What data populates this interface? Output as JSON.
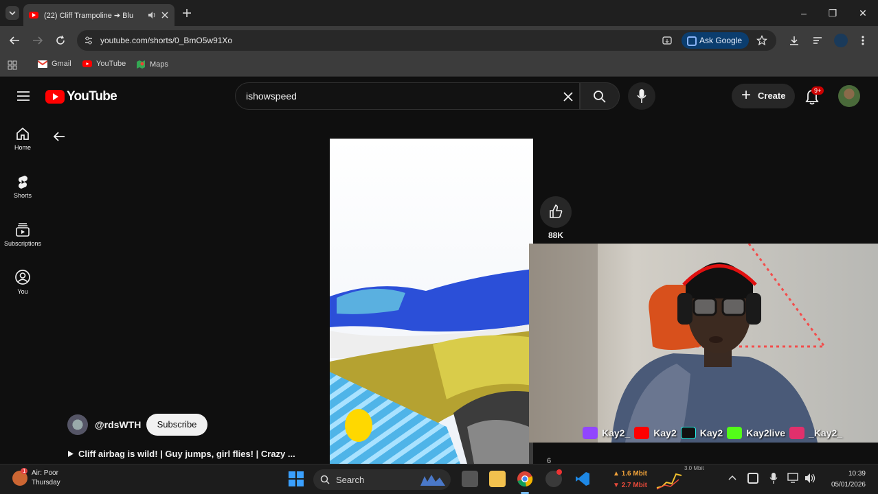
{
  "browser": {
    "tab_title": "(22) Cliff Trampoline ➔ Blu",
    "url": "youtube.com/shorts/0_BmO5w91Xo",
    "ask_google_label": "Ask Google",
    "bookmarks": [
      {
        "label": "Gmail"
      },
      {
        "label": "YouTube"
      },
      {
        "label": "Maps"
      }
    ]
  },
  "youtube": {
    "logo_text": "YouTube",
    "search_value": "ishowspeed",
    "create_label": "Create",
    "notification_badge": "9+",
    "sidebar": [
      {
        "label": "Home"
      },
      {
        "label": "Shorts"
      },
      {
        "label": "Subscriptions"
      },
      {
        "label": "You"
      }
    ],
    "short": {
      "like_count": "88K",
      "comment_count": "6",
      "channel": "@rdsWTH",
      "subscribe_label": "Subscribe",
      "title": "Cliff airbag is wild! | Guy jumps, girl flies! | Crazy ..."
    }
  },
  "overlay": {
    "handles": [
      "Kay2_",
      "Kay2",
      "Kay2",
      "Kay2live",
      "_Kay2_"
    ],
    "colors": {
      "twitch": "#9146ff",
      "youtube": "#ff0000",
      "tiktok": "#111111",
      "kick": "#53fc18",
      "instagram": "#e1306c"
    }
  },
  "taskbar": {
    "weather_line1": "Air: Poor",
    "weather_line2": "Thursday",
    "weather_badge": "1",
    "search_label": "Search",
    "upload_speed": "1.6 Mbit",
    "download_speed": "2.7 Mbit",
    "graph_max": "3.0 Mbit",
    "time": "10:39",
    "date": "05/01/2026"
  }
}
